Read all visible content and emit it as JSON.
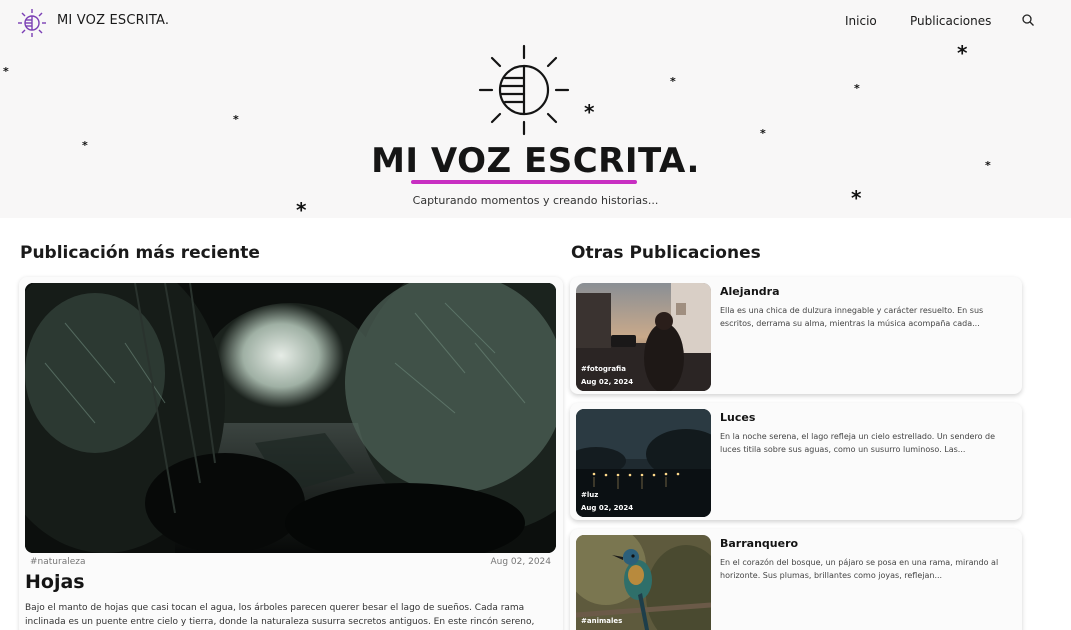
{
  "nav": {
    "logo_text": "MI VOZ ESCRITA.",
    "links": [
      "Inicio",
      "Publicaciones"
    ],
    "search_icon": "search-icon"
  },
  "hero": {
    "title": "MI VOZ ESCRITA.",
    "subtitle": "Capturando momentos y creando historias...",
    "underline_color": "#c82fc2",
    "logo_icon": "sun-icon"
  },
  "featured": {
    "section_title": "Publicación más reciente",
    "tag": "#naturaleza",
    "date": "Aug 02, 2024",
    "title": "Hojas",
    "excerpt": "Bajo el manto de hojas que casi tocan el agua, los árboles parecen querer besar el lago de sueños. Cada rama inclinada es un puente entre cielo y tierra, donde la naturaleza susurra secretos antiguos. En este rincón sereno, el"
  },
  "others": {
    "section_title": "Otras Publicaciones",
    "posts": [
      {
        "title": "Alejandra",
        "excerpt": "Ella es una chica de dulzura innegable y carácter resuelto. En sus escritos, derrama su alma, mientras la música acompaña cada...",
        "tag": "#fotografia",
        "date": "Aug 02, 2024"
      },
      {
        "title": "Luces",
        "excerpt": "En la noche serena, el lago refleja un cielo estrellado. Un sendero de luces titila sobre sus aguas, como un susurro luminoso. Las...",
        "tag": "#luz",
        "date": "Aug 02, 2024"
      },
      {
        "title": "Barranquero",
        "excerpt": "En el corazón del bosque, un pájaro se posa en una rama, mirando al horizonte. Sus plumas, brillantes como joyas, reflejan...",
        "tag": "#animales",
        "date": ""
      }
    ]
  }
}
